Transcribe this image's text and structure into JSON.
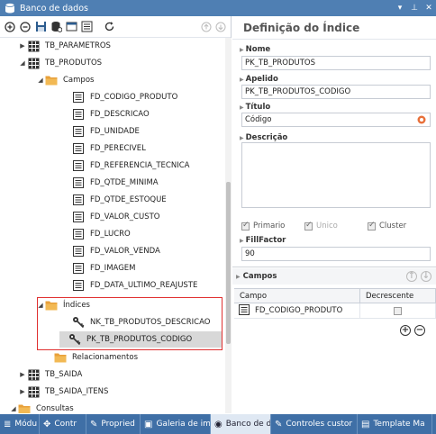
{
  "window": {
    "title": "Banco de dados",
    "dropdown_glyph": "▾",
    "pin_glyph": "⊥",
    "close_glyph": "✕"
  },
  "tree": {
    "nodes": [
      {
        "label": "TB_PARAMETROS",
        "arrow": "▶",
        "icon": "table-icon"
      },
      {
        "label": "TB_PRODUTOS",
        "arrow": "◢",
        "icon": "table-icon"
      },
      {
        "label": "Campos",
        "arrow": "◢",
        "icon": "folder-icon"
      },
      {
        "label": "FD_CODIGO_PRODUTO",
        "icon": "field-icon"
      },
      {
        "label": "FD_DESCRICAO",
        "icon": "field-icon"
      },
      {
        "label": "FD_UNIDADE",
        "icon": "field-icon"
      },
      {
        "label": "FD_PERECIVEL",
        "icon": "field-icon"
      },
      {
        "label": "FD_REFERENCIA_TECNICA",
        "icon": "field-icon"
      },
      {
        "label": "FD_QTDE_MINIMA",
        "icon": "field-icon"
      },
      {
        "label": "FD_QTDE_ESTOQUE",
        "icon": "field-icon"
      },
      {
        "label": "FD_VALOR_CUSTO",
        "icon": "field-icon"
      },
      {
        "label": "FD_LUCRO",
        "icon": "field-icon"
      },
      {
        "label": "FD_VALOR_VENDA",
        "icon": "field-icon"
      },
      {
        "label": "FD_IMAGEM",
        "icon": "field-icon"
      },
      {
        "label": "FD_DATA_ULTIMO_REAJUSTE",
        "icon": "field-icon"
      },
      {
        "label": "Índices",
        "arrow": "◢",
        "icon": "folder-icon"
      },
      {
        "label": "NK_TB_PRODUTOS_DESCRICAO",
        "icon": "key-icon"
      },
      {
        "label": "PK_TB_PRODUTOS_CODIGO",
        "icon": "key-icon",
        "selected": true
      },
      {
        "label": "Relacionamentos",
        "icon": "folder-icon"
      },
      {
        "label": "TB_SAIDA",
        "arrow": "▶",
        "icon": "table-icon"
      },
      {
        "label": "TB_SAIDA_ITENS",
        "arrow": "▶",
        "icon": "table-icon"
      },
      {
        "label": "Consultas",
        "arrow": "◢",
        "icon": "folder-icon"
      }
    ]
  },
  "detail": {
    "title": "Definição do Índice",
    "nome_label": "Nome",
    "nome_value": "PK_TB_PRODUTOS",
    "apelido_label": "Apelido",
    "apelido_value": "PK_TB_PRODUTOS_CODIGO",
    "titulo_label": "Título",
    "titulo_value": "Código",
    "descricao_label": "Descrição",
    "primario_label": "Primario",
    "unico_label": "Unico",
    "cluster_label": "Cluster",
    "primario_checked": true,
    "unico_checked": true,
    "cluster_checked": true,
    "checkmark": "✓",
    "fillfactor_label": "FillFactor",
    "fillfactor_value": "90",
    "campos_label": "Campos",
    "grid_col_campo": "Campo",
    "grid_col_decrescente": "Decrescente",
    "grid_rows": [
      {
        "campo": "FD_CODIGO_PRODUTO",
        "decrescente": false
      }
    ],
    "add_glyph": "+",
    "remove_glyph": "−"
  },
  "bottom_tabs": [
    {
      "label": "Módu",
      "icon": "layers-icon",
      "glyph": "≣"
    },
    {
      "label": "Contr",
      "icon": "tools-icon",
      "glyph": "✥"
    },
    {
      "label": "Propried",
      "icon": "wrench-icon",
      "glyph": "✎"
    },
    {
      "label": "Galeria de im",
      "icon": "image-icon",
      "glyph": "▣"
    },
    {
      "label": "Banco de d",
      "icon": "database-icon",
      "glyph": "◉",
      "active": true
    },
    {
      "label": "Controles custor",
      "icon": "edit-icon",
      "glyph": "✎"
    },
    {
      "label": "Template Ma",
      "icon": "template-icon",
      "glyph": "▤"
    }
  ],
  "colors": {
    "accent": "#4f7fb3",
    "highlight_border": "#e03030",
    "folder": "#e8a03a"
  }
}
